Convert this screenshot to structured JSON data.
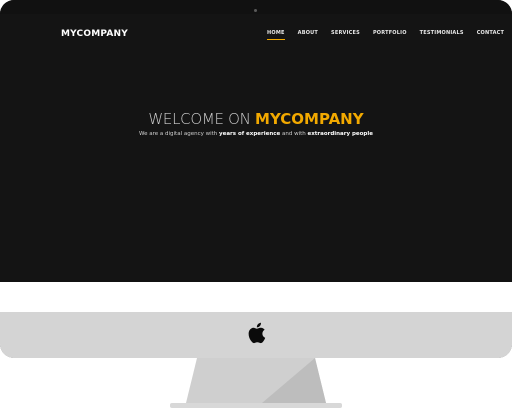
{
  "site": {
    "logo": "MYCOMPANY",
    "nav": [
      {
        "label": "HOME",
        "active": true
      },
      {
        "label": "ABOUT",
        "active": false
      },
      {
        "label": "SERVICES",
        "active": false
      },
      {
        "label": "PORTFOLIO",
        "active": false
      },
      {
        "label": "TESTIMONIALS",
        "active": false
      },
      {
        "label": "CONTACT",
        "active": false
      }
    ],
    "hero": {
      "title_prefix": "WELCOME ON ",
      "title_brand": "MYCOMPANY",
      "sub_part1": "We are a digital agency with ",
      "sub_bold1": "years of experience",
      "sub_part2": " and with ",
      "sub_bold2": "extraordinary people"
    }
  },
  "colors": {
    "accent": "#f2a900",
    "screen_bg": "#141414",
    "chin": "#d4d4d4"
  },
  "icons": {
    "brand_logo": "apple-logo-icon",
    "camera": "camera-icon"
  }
}
